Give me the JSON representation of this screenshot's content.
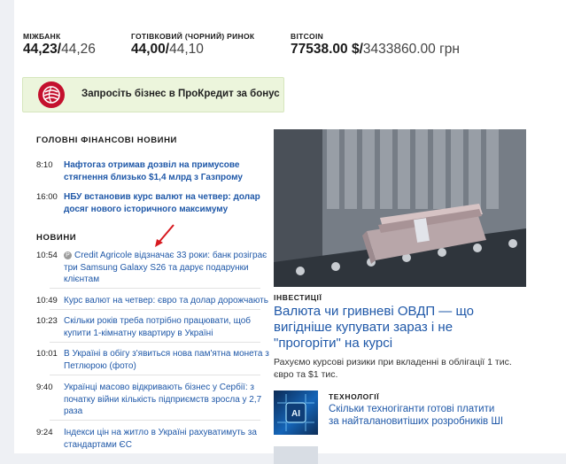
{
  "rates": [
    {
      "label": "МІЖБАНК",
      "main": "44,23",
      "sep": "/",
      "secondary": "44,26"
    },
    {
      "label": "ГОТІВКОВИЙ (ЧОРНИЙ) РИНОК",
      "main": "44,00",
      "sep": "/",
      "secondary": "44,10"
    },
    {
      "label": "BITCOIN",
      "main": "77538.00 $",
      "sep": "/",
      "secondary": "3433860.00 грн"
    }
  ],
  "banner": {
    "text": "Запросіть бізнес в ПроКредит за бонус",
    "icon": "globe-icon",
    "color": "#c4102d"
  },
  "main_news": {
    "title": "ГОЛОВНІ ФІНАНСОВІ НОВИНИ",
    "items": [
      {
        "time": "8:10",
        "title": "Нафтогаз отримав дозвіл на примусове стягнення близько $1,4 млрд з Газпрому"
      },
      {
        "time": "16:00",
        "title": "НБУ встановив курс валют на четвер: долар досяг нового історичного максимуму"
      }
    ]
  },
  "news": {
    "title": "НОВИНИ",
    "items": [
      {
        "time": "10:54",
        "badge": "P",
        "title": "Credit Agricole відзначає 33 роки: банк розіграє три Samsung Galaxy S26 та дарує подарунки клієнтам"
      },
      {
        "time": "10:49",
        "title": "Курс валют на четвер: євро та долар дорожчають"
      },
      {
        "time": "10:23",
        "title": "Скільки років треба потрібно працювати, щоб купити 1-кімнатну квартиру в Україні"
      },
      {
        "time": "10:01",
        "title": "В Україні в обігу з'явиться нова пам'ятна монета з Петлюрою (фото)"
      },
      {
        "time": "9:40",
        "title": "Українці масово відкривають бізнес у Сербії: з початку війни кількість підприємств зросла у 2,7 раза"
      },
      {
        "time": "9:24",
        "title": "Індекси цін на житло в Україні рахуватимуть за стандартами ЄС"
      }
    ]
  },
  "featured": {
    "category": "ІНВЕСТИЦІЇ",
    "title": "Валюта чи гривневі ОВДП — що вигідніше купувати зараз і не \"прогоріти\" на курсі",
    "lead": "Рахуємо курсові ризики при вкладенні в облігації 1 тис. євро та $1 тис."
  },
  "secondary_story": {
    "category": "ТЕХНОЛОГІЇ",
    "title": "Скільки техногіганти готові платити за найталановитіших розробників ШІ",
    "thumb_label": "AI"
  }
}
